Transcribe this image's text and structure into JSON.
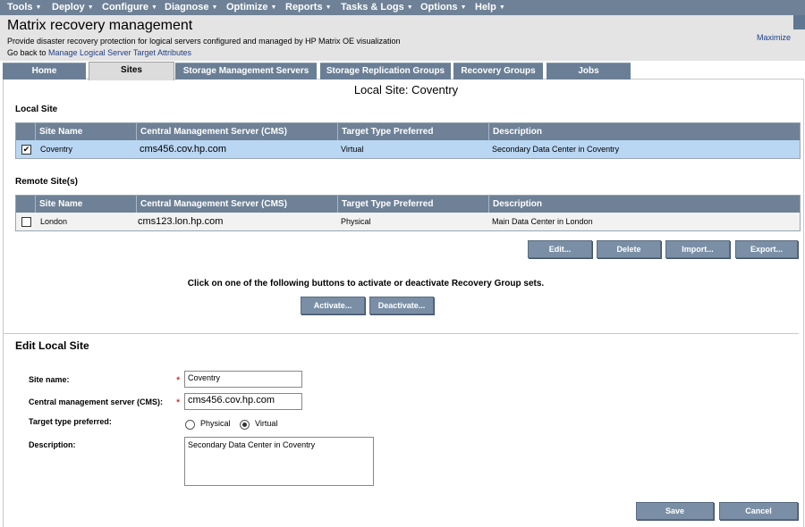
{
  "menubar": {
    "items": [
      {
        "label": "Tools"
      },
      {
        "label": "Deploy"
      },
      {
        "label": "Configure"
      },
      {
        "label": "Diagnose"
      },
      {
        "label": "Optimize"
      },
      {
        "label": "Reports"
      },
      {
        "label": "Tasks & Logs"
      },
      {
        "label": "Options"
      },
      {
        "label": "Help"
      }
    ]
  },
  "header": {
    "title": "Matrix recovery management",
    "subtitle": "Provide disaster recovery protection for logical servers configured and managed by HP Matrix OE visualization",
    "goback_prefix": "Go back to ",
    "goback_link": "Manage Logical Server Target Attributes",
    "maximize": "Maximize"
  },
  "tabs": [
    {
      "label": "Home",
      "active": false
    },
    {
      "label": "Sites",
      "active": true
    },
    {
      "label": "Storage Management Servers",
      "active": false
    },
    {
      "label": "Storage Replication Groups",
      "active": false
    },
    {
      "label": "Recovery Groups",
      "active": false
    },
    {
      "label": "Jobs",
      "active": false
    }
  ],
  "page_title": "Local Site: Coventry",
  "local_site": {
    "label": "Local Site",
    "columns": [
      "Site Name",
      "Central Management Server (CMS)",
      "Target Type Preferred",
      "Description"
    ],
    "rows": [
      {
        "checked": true,
        "site": "Coventry",
        "cms": "cms456.cov.hp.com",
        "target": "Virtual",
        "description": "Secondary Data Center in Coventry"
      }
    ]
  },
  "remote_sites": {
    "label": "Remote Site(s)",
    "columns": [
      "Site Name",
      "Central Management Server (CMS)",
      "Target Type Preferred",
      "Description"
    ],
    "rows": [
      {
        "checked": false,
        "site": "London",
        "cms": "cms123.lon.hp.com",
        "target": "Physical",
        "description": "Main Data Center in London"
      }
    ]
  },
  "actions": {
    "edit": "Edit...",
    "delete": "Delete",
    "import": "Import...",
    "export": "Export..."
  },
  "activation": {
    "text": "Click on one of the following buttons to activate or deactivate Recovery Group sets.",
    "activate": "Activate...",
    "deactivate": "Deactivate..."
  },
  "edit_form": {
    "title": "Edit Local Site",
    "site_name_label": "Site name:",
    "site_name_value": "Coventry",
    "cms_label": "Central management server (CMS):",
    "cms_value": "cms456.cov.hp.com",
    "target_label": "Target type preferred:",
    "options": [
      "Physical",
      "Virtual"
    ],
    "selected_option": "Virtual",
    "description_label": "Description:",
    "description_value": "Secondary Data Center in Coventry",
    "required_mark": "*"
  },
  "footer": {
    "save": "Save",
    "cancel": "Cancel"
  },
  "colors": {
    "menubar": "#6e8196",
    "tab": "#6a7f95",
    "selected_row": "#b9d6f2",
    "button": "#7a8fa6",
    "link": "#1f3f86",
    "required": "#c00000"
  }
}
